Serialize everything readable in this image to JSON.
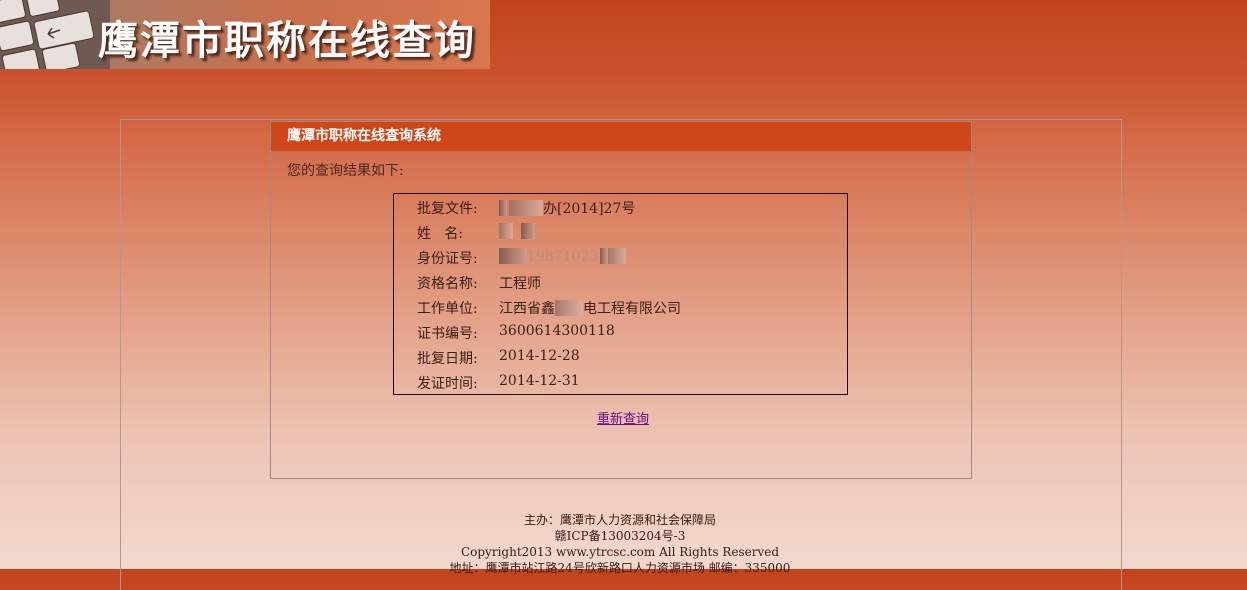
{
  "banner": {
    "title": "鹰潭市职称在线查询"
  },
  "result": {
    "header": "鹰潭市职称在线查询系统",
    "intro": "您的查询结果如下:",
    "fields": [
      {
        "label": "批复文件:",
        "value": "办[2014]27号"
      },
      {
        "label": "姓   名:",
        "value": ""
      },
      {
        "label": "身份证号:",
        "value": "19871023"
      },
      {
        "label": "资格名称:",
        "value": "工程师"
      },
      {
        "label": "工作单位:",
        "value_prefix": "江西省鑫",
        "value_suffix": "电工程有限公司"
      },
      {
        "label": "证书编号:",
        "value": "3600614300118"
      },
      {
        "label": "批复日期:",
        "value": "2014-12-28"
      },
      {
        "label": "发证时间:",
        "value": "2014-12-31"
      }
    ],
    "requery_label": "重新查询"
  },
  "footer": {
    "sponsor": "主办：鹰潭市人力资源和社会保障局",
    "icp": "赣ICP备13003204号-3",
    "copyright": "Copyright2013 www.ytrcsc.com All Rights Reserved",
    "address": "地址：鹰潭市站江路24号欣新路口人力资源市场      邮编：335000"
  },
  "colors": {
    "header_bg": "#cf4618",
    "link": "#6a0c8a"
  }
}
